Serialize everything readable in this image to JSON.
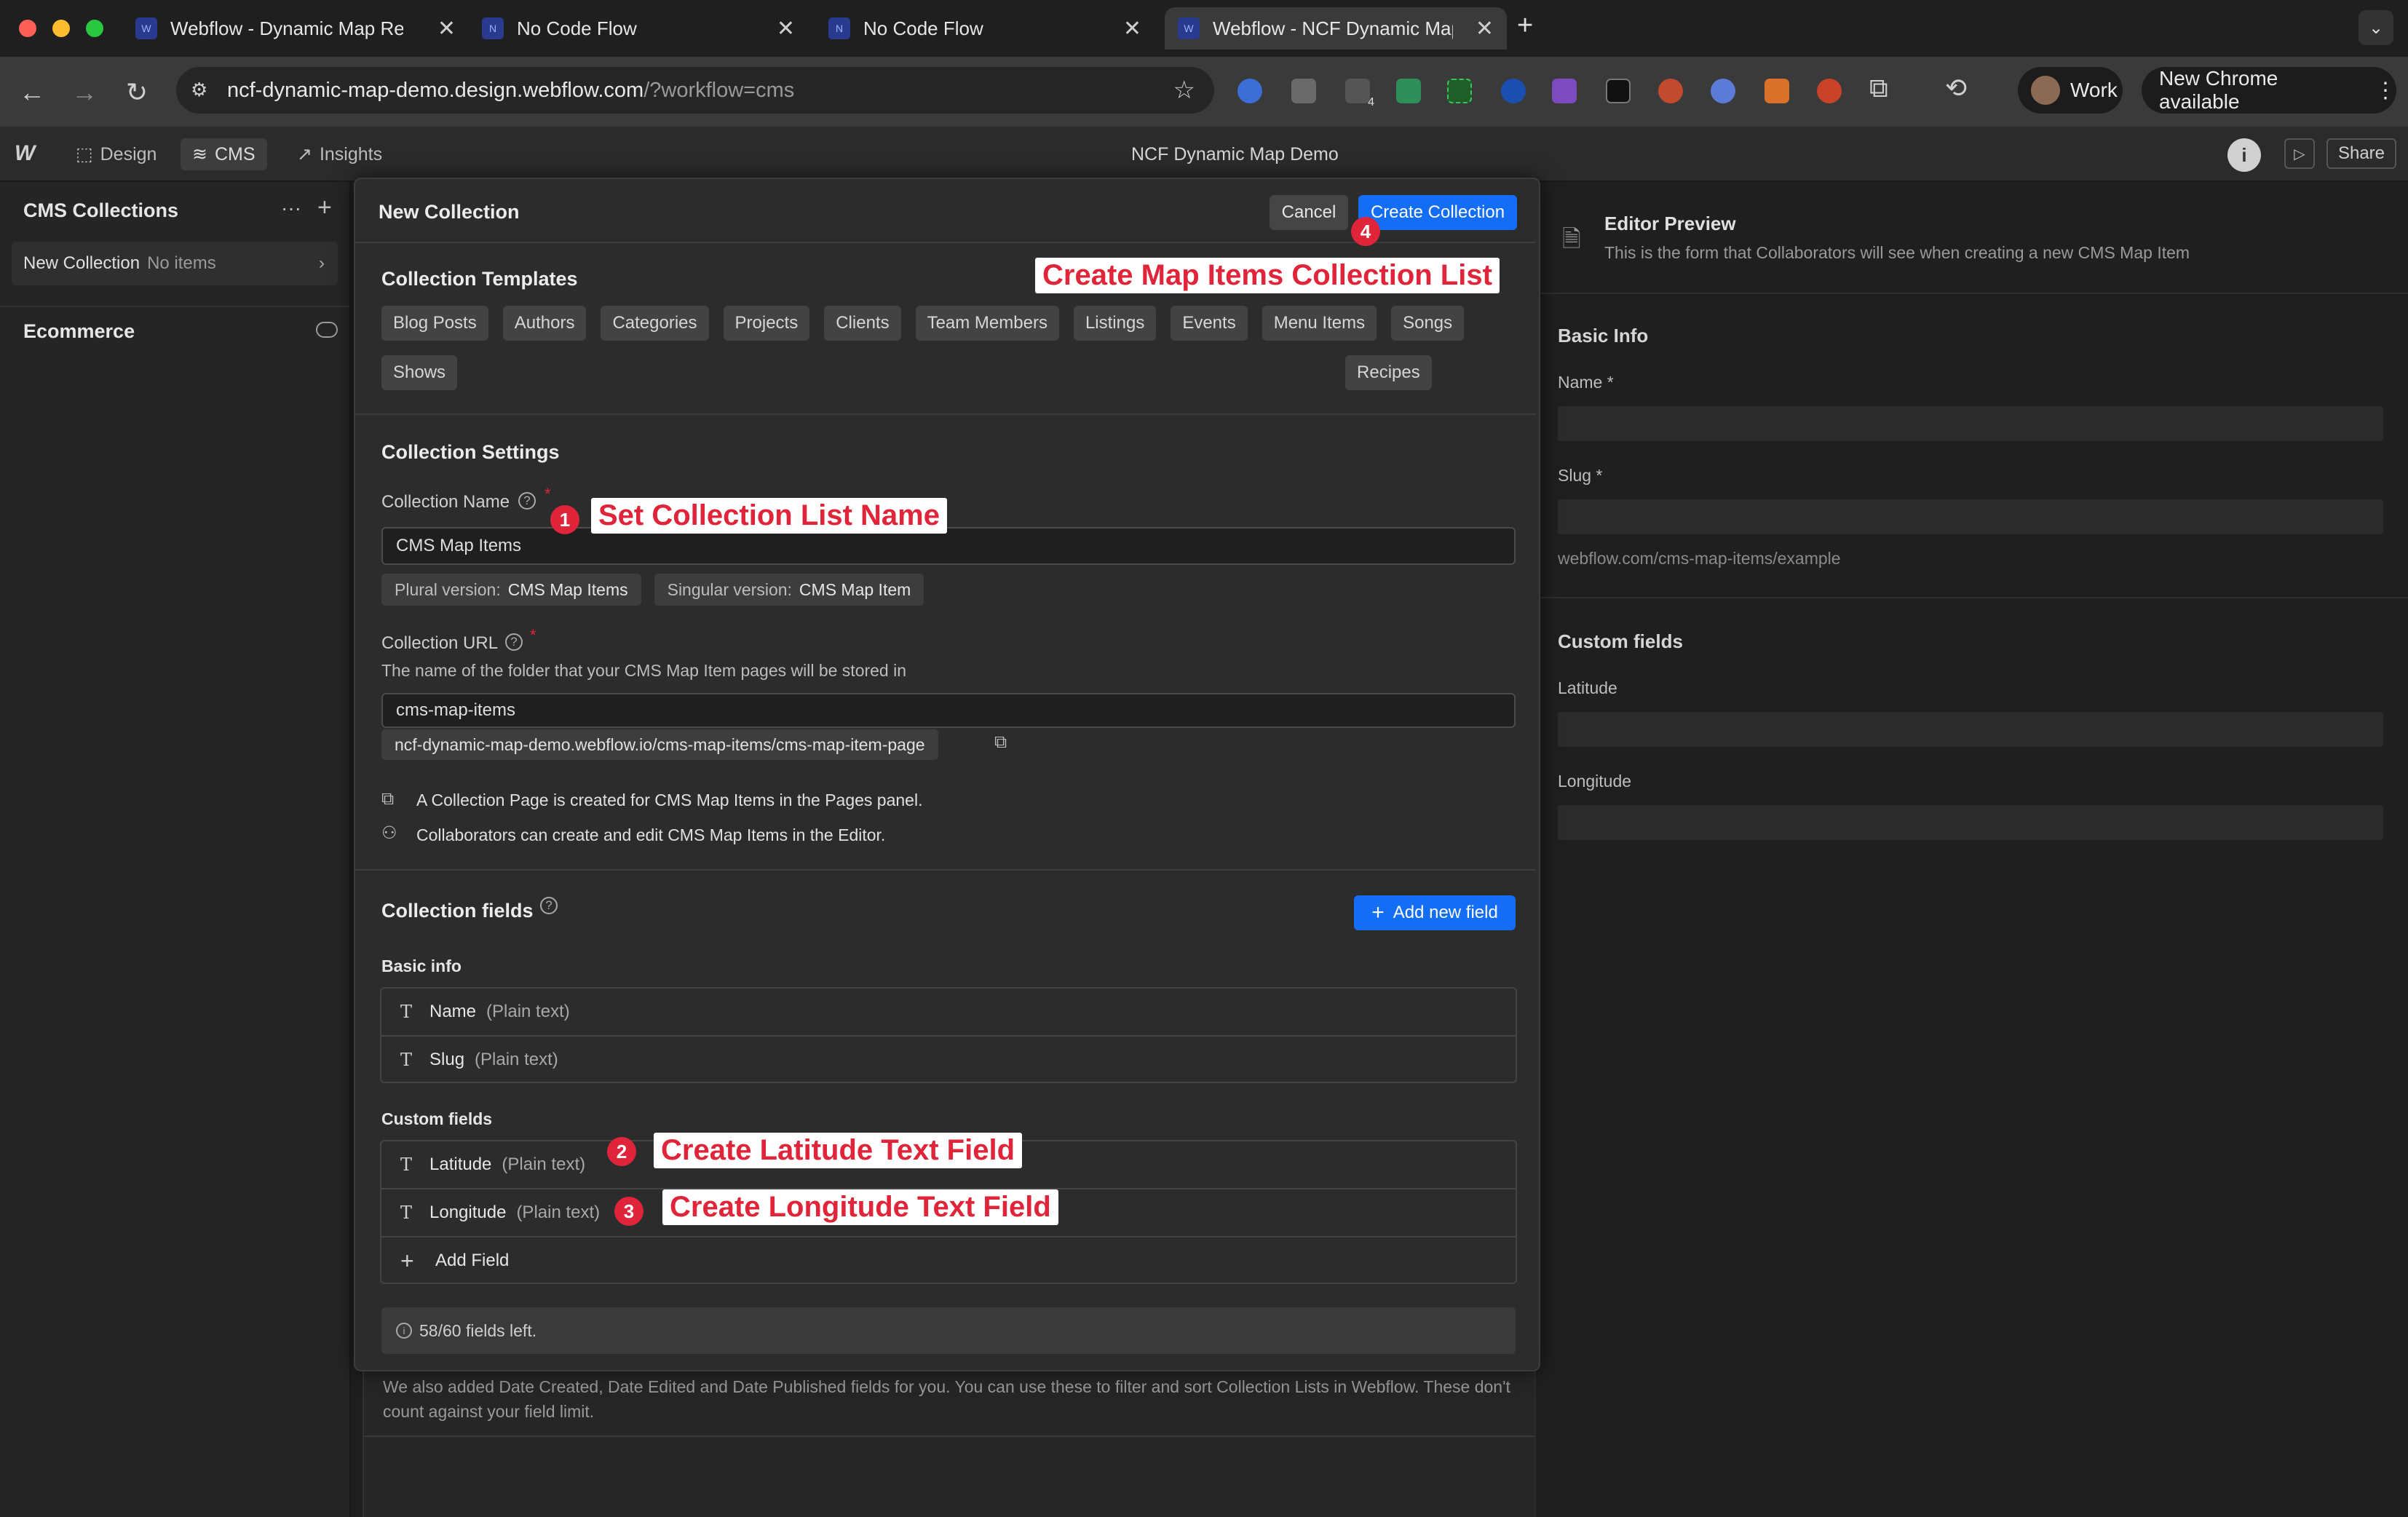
{
  "browser": {
    "tabs": [
      {
        "title": "Webflow - Dynamic Map Real",
        "favicon": "webflow-icon"
      },
      {
        "title": "No Code Flow",
        "favicon": "ncf-icon"
      },
      {
        "title": "No Code Flow",
        "favicon": "ncf-icon"
      },
      {
        "title": "Webflow - NCF Dynamic Map",
        "favicon": "webflow-icon"
      }
    ],
    "url_main": "ncf-dynamic-map-demo.design.webflow.com",
    "url_path": "/?workflow=cms",
    "profile_label": "Work",
    "update_label": "New Chrome available",
    "extension_badge": "4"
  },
  "webflow": {
    "nav": {
      "design": "Design",
      "cms": "CMS",
      "insights": "Insights"
    },
    "project_title": "NCF Dynamic Map Demo",
    "share_label": "Share"
  },
  "sidebar": {
    "title": "CMS Collections",
    "collection_name": "New Collection",
    "collection_count": "No items",
    "ecommerce_label": "Ecommerce"
  },
  "modal": {
    "title": "New Collection",
    "cancel_label": "Cancel",
    "create_label": "Create Collection",
    "templates_heading": "Collection Templates",
    "templates": [
      "Blog Posts",
      "Authors",
      "Categories",
      "Projects",
      "Clients",
      "Team Members",
      "Listings",
      "Events",
      "Menu Items",
      "Songs",
      "Shows",
      "Recipes"
    ],
    "settings_heading": "Collection Settings",
    "name_label": "Collection Name",
    "required_mark": "*",
    "name_value": "CMS Map Items",
    "plural_label": "Plural version:",
    "plural_value": "CMS Map Items",
    "singular_label": "Singular version:",
    "singular_value": "CMS Map Item",
    "url_label": "Collection URL",
    "url_help": "The name of the folder that your CMS Map Item pages will be stored in",
    "url_value": "cms-map-items",
    "url_preview": "ncf-dynamic-map-demo.webflow.io/cms-map-items/cms-map-item-page",
    "info_page": "A Collection Page is created for CMS Map Items in the Pages panel.",
    "info_editor": "Collaborators can create and edit CMS Map Items in the Editor.",
    "fields_heading": "Collection fields",
    "add_field_label": "Add new field",
    "basic_info_label": "Basic info",
    "basic_fields": [
      {
        "name": "Name",
        "type": "(Plain text)"
      },
      {
        "name": "Slug",
        "type": "(Plain text)"
      }
    ],
    "custom_fields_label": "Custom fields",
    "custom_fields": [
      {
        "name": "Latitude",
        "type": "(Plain text)"
      },
      {
        "name": "Longitude",
        "type": "(Plain text)"
      }
    ],
    "add_row_label": "Add Field",
    "field_limit": "58/60 fields left.",
    "footnote": "We also added Date Created, Date Edited and Date Published fields for you. You can use these to filter and sort Collection Lists in Webflow. These don't count against your field limit."
  },
  "annotations": {
    "create_list": "Create Map Items Collection List",
    "set_name": "Set Collection List Name",
    "latitude": "Create Latitude Text Field",
    "longitude": "Create Longitude Text Field",
    "steps": [
      "1",
      "2",
      "3",
      "4"
    ]
  },
  "preview": {
    "title": "Editor Preview",
    "subtitle": "This is the form that Collaborators will see when creating a new CMS Map Item",
    "basic_heading": "Basic Info",
    "name_label": "Name *",
    "slug_label": "Slug *",
    "slug_example": "webflow.com/cms-map-items/example",
    "custom_heading": "Custom fields",
    "lat_label": "Latitude",
    "lng_label": "Longitude"
  },
  "colors": {
    "accent": "#146ef5",
    "annotation": "#e0243a"
  }
}
